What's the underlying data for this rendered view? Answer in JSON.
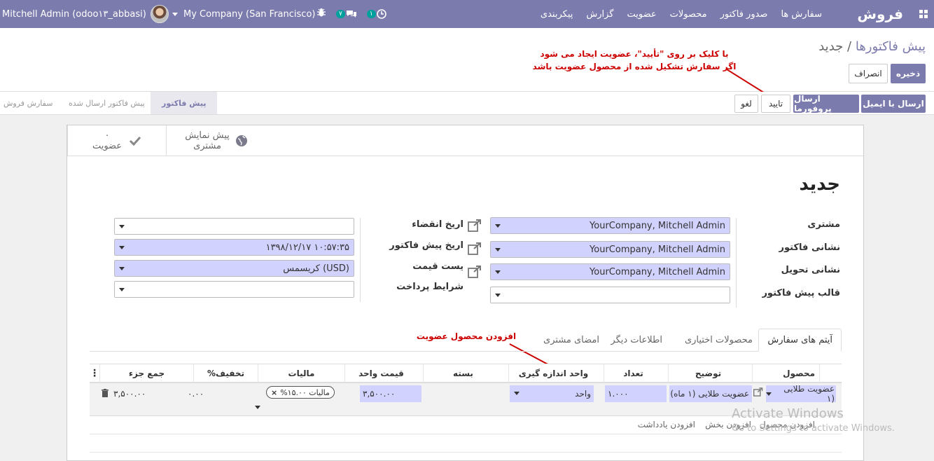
{
  "navbar": {
    "user": "Mitchell Admin (odoo۱۳_abbasi)",
    "company": "My Company (San Francisco)",
    "chat_badge": "۷",
    "activity_badge": "۱",
    "brand": "فروش",
    "menu": [
      "سفارش ها",
      "صدور فاکتور",
      "محصولات",
      "عضویت",
      "گزارش",
      "پیکربندی"
    ]
  },
  "breadcrumb": {
    "parent": "پیش فاکتورها",
    "separator": "/",
    "current": "جدید"
  },
  "header_buttons": {
    "save": "ذخیره",
    "discard": "انصراف"
  },
  "annotations": {
    "confirm_line1": "با کلیک بر روی \"تأیید\"، عضویت ایجاد می شود",
    "confirm_line2": "اگر سفارش تشکیل شده از محصول عضویت باشد",
    "add_product": "افزودن محصول عضویت"
  },
  "action_buttons": {
    "send_email": "ارسال با ایمیل",
    "send_proforma": "ارسال پروفورما",
    "confirm": "تایید",
    "cancel": "لغو"
  },
  "stages": {
    "quotation": "پیش فاکتور",
    "quotation_sent": "پیش فاکتور ارسال شده",
    "sale_order": "سفارش فروش"
  },
  "smart_buttons": {
    "preview_line1": "پیش نمایش",
    "preview_line2": "مشتری",
    "membership_count": "۰",
    "membership_label": "عضویت"
  },
  "form": {
    "title": "جدید",
    "labels": {
      "customer": "مشتری",
      "invoice_address": "نشانی فاکتور",
      "delivery_address": "نشانی تحویل",
      "quotation_template": "قالب پیش فاکتور",
      "expiration": "اریخ انقضاء",
      "quotation_date": "اریخ پیش فاکتور",
      "pricelist": "یست قیمت",
      "payment_terms": "شرایط پرداخت"
    },
    "values": {
      "customer": "YourCompany, Mitchell Admin",
      "invoice_address": "YourCompany, Mitchell Admin",
      "delivery_address": "YourCompany, Mitchell Admin",
      "quotation_date": "۱۳۹۸/۱۲/۱۷ ۱۰:۵۷:۳۵",
      "pricelist": "کریسمس (USD)"
    }
  },
  "tabs": [
    "آیتم های سفارش",
    "محصولات اختیاری",
    "اطلاعات دیگر",
    "امضای مشتری"
  ],
  "table": {
    "headers": [
      "محصول",
      "توضیح",
      "تعداد",
      "واحد اندازه گیری",
      "بسته",
      "قیمت واحد",
      "مالیات",
      "تخفیف%",
      "جمع جزء"
    ],
    "row": {
      "product": "عضویت طلایی (۱",
      "description": "عضویت طلایی (۱ ماه)",
      "quantity": "۱.۰۰۰",
      "uom": "واحد",
      "unit_price": "۳,۵۰۰.۰۰",
      "tax": "مالیات ۱۵.۰۰%",
      "discount": "۰.۰۰",
      "subtotal": "۳,۵۰۰.۰۰"
    },
    "links": {
      "add_product": "افزودن محصول",
      "add_section": "افزودن بخش",
      "add_note": "افزودن یادداشت"
    }
  },
  "watermark": {
    "line1": "Activate Windows",
    "line2": "Go to Settings to activate Windows."
  }
}
